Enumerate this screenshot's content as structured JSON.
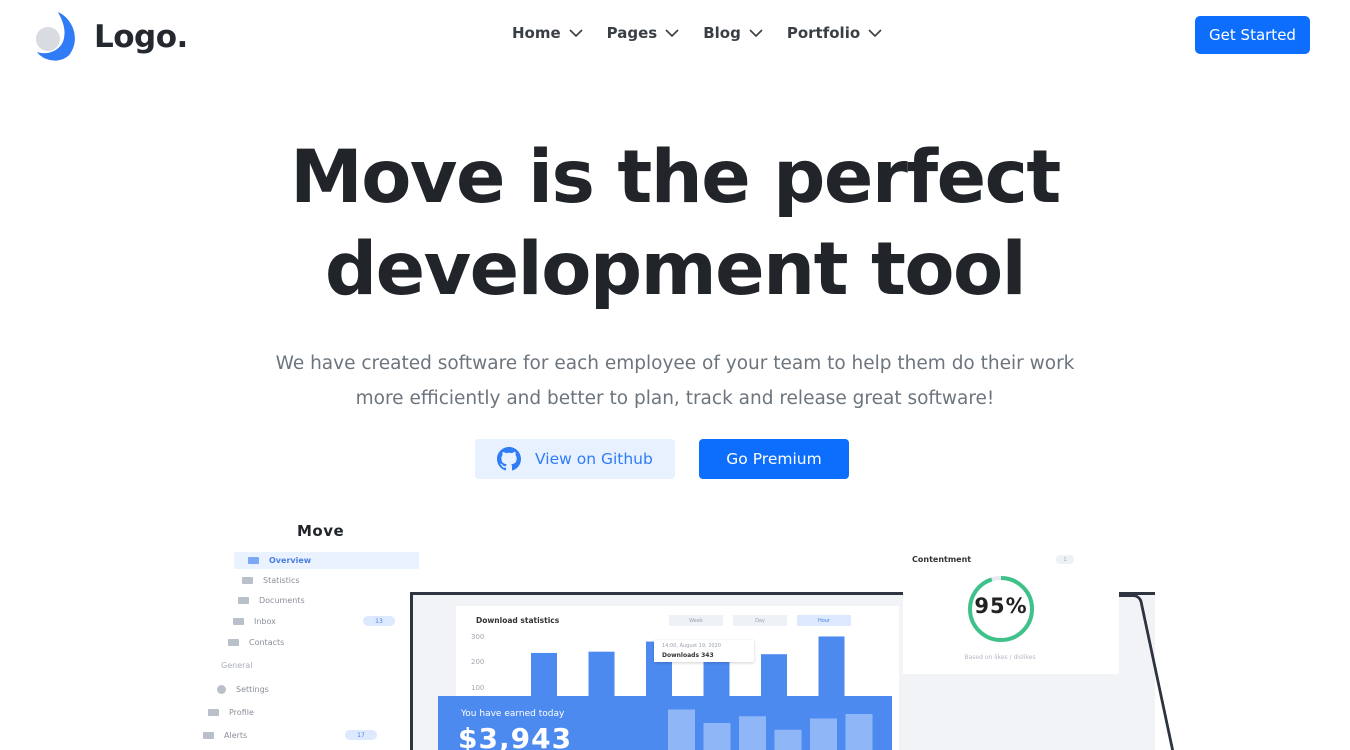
{
  "header": {
    "logo_text": "Logo.",
    "nav": [
      {
        "label": "Home"
      },
      {
        "label": "Pages"
      },
      {
        "label": "Blog"
      },
      {
        "label": "Portfolio"
      }
    ],
    "cta_label": "Get Started"
  },
  "hero": {
    "title_line1": "Move is the perfect",
    "title_line2": "development tool",
    "subtitle_line1": "We have created software for each employee of your team to help them do their work",
    "subtitle_line2": "more efficiently and better to plan, track and release great software!",
    "github_label": "View on Github",
    "premium_label": "Go Premium"
  },
  "mockup": {
    "brand": "Move",
    "sidebar": [
      {
        "label": "Overview",
        "active": true
      },
      {
        "label": "Statistics"
      },
      {
        "label": "Documents"
      },
      {
        "label": "Inbox",
        "badge": "13"
      },
      {
        "label": "Contacts"
      },
      {
        "label": "General",
        "section": true
      },
      {
        "label": "Settings"
      },
      {
        "label": "Profile"
      },
      {
        "label": "Alerts",
        "badge": "17"
      }
    ],
    "download_title": "Download statistics",
    "range_pills": [
      "Week",
      "Day",
      "Hour"
    ],
    "tooltip": {
      "date": "14:00, August 19, 2020",
      "text": "Downloads 343"
    },
    "earn_label": "You have earned today",
    "earn_value": "$3,943",
    "contentment": {
      "title": "Contentment",
      "badge": "1",
      "value": "95%",
      "percent": 95,
      "note": "Based on likes / dislikes"
    },
    "colors": {
      "accent": "#0d6efd",
      "ring": "#3ec28a",
      "bar": "#4d8af0"
    }
  },
  "chart_data": {
    "type": "bar",
    "title": "Download statistics",
    "y_ticks": [
      "300",
      "200",
      "100"
    ],
    "ylim": [
      0,
      300
    ],
    "values": [
      170,
      175,
      215,
      145,
      165,
      235
    ],
    "earn_overlay_values": [
      90,
      60,
      75,
      45,
      70,
      80
    ]
  }
}
